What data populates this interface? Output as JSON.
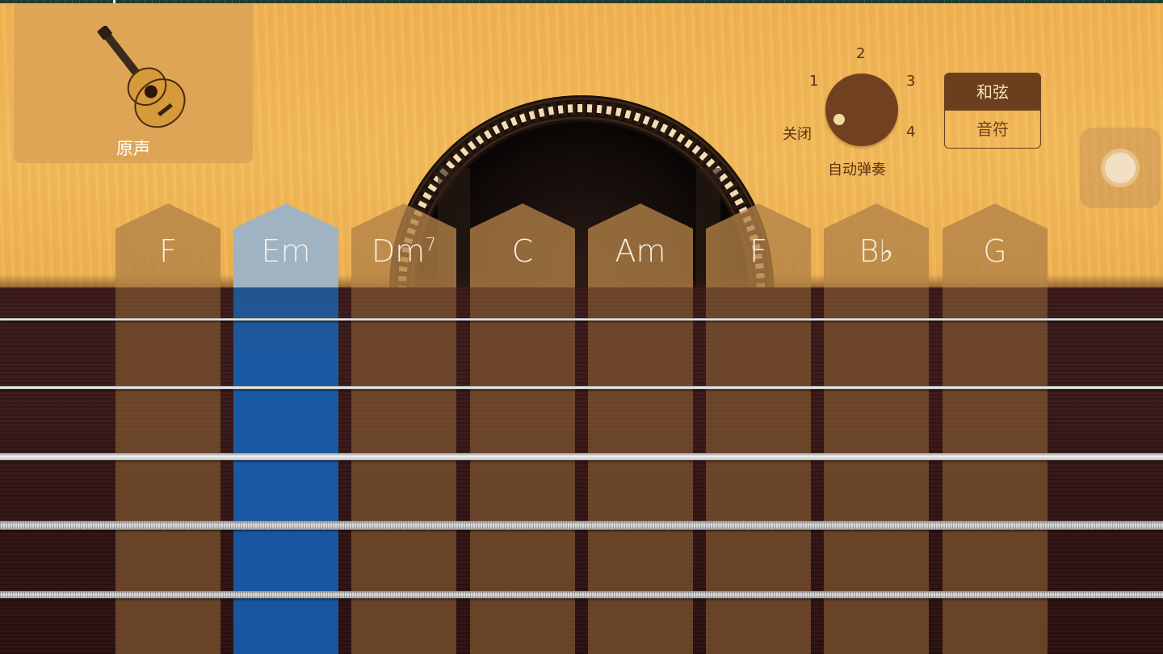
{
  "instrument": {
    "name": "原声",
    "icon": "acoustic-guitar-icon"
  },
  "autoplay": {
    "label": "自动弹奏",
    "off_label": "关闭",
    "positions": [
      "1",
      "2",
      "3",
      "4"
    ],
    "selected": "关闭"
  },
  "mode_toggle": {
    "chords_label": "和弦",
    "notes_label": "音符",
    "active": "和弦"
  },
  "chords": [
    {
      "root": "F",
      "sup": "",
      "selected": false
    },
    {
      "root": "Em",
      "sup": "",
      "selected": true
    },
    {
      "root": "Dm",
      "sup": "7",
      "selected": false
    },
    {
      "root": "C",
      "sup": "",
      "selected": false
    },
    {
      "root": "Am",
      "sup": "",
      "selected": false
    },
    {
      "root": "F",
      "sup": "",
      "selected": false
    },
    {
      "root": "B♭",
      "sup": "",
      "selected": false
    },
    {
      "root": "G",
      "sup": "",
      "selected": false
    }
  ],
  "colors": {
    "wood": "#f0b455",
    "fretboard": "#3a1818",
    "selected_strip": "#1a5aa3",
    "knob": "#70401f"
  },
  "assistive_touch": {
    "icon": "assistive-touch-icon"
  }
}
